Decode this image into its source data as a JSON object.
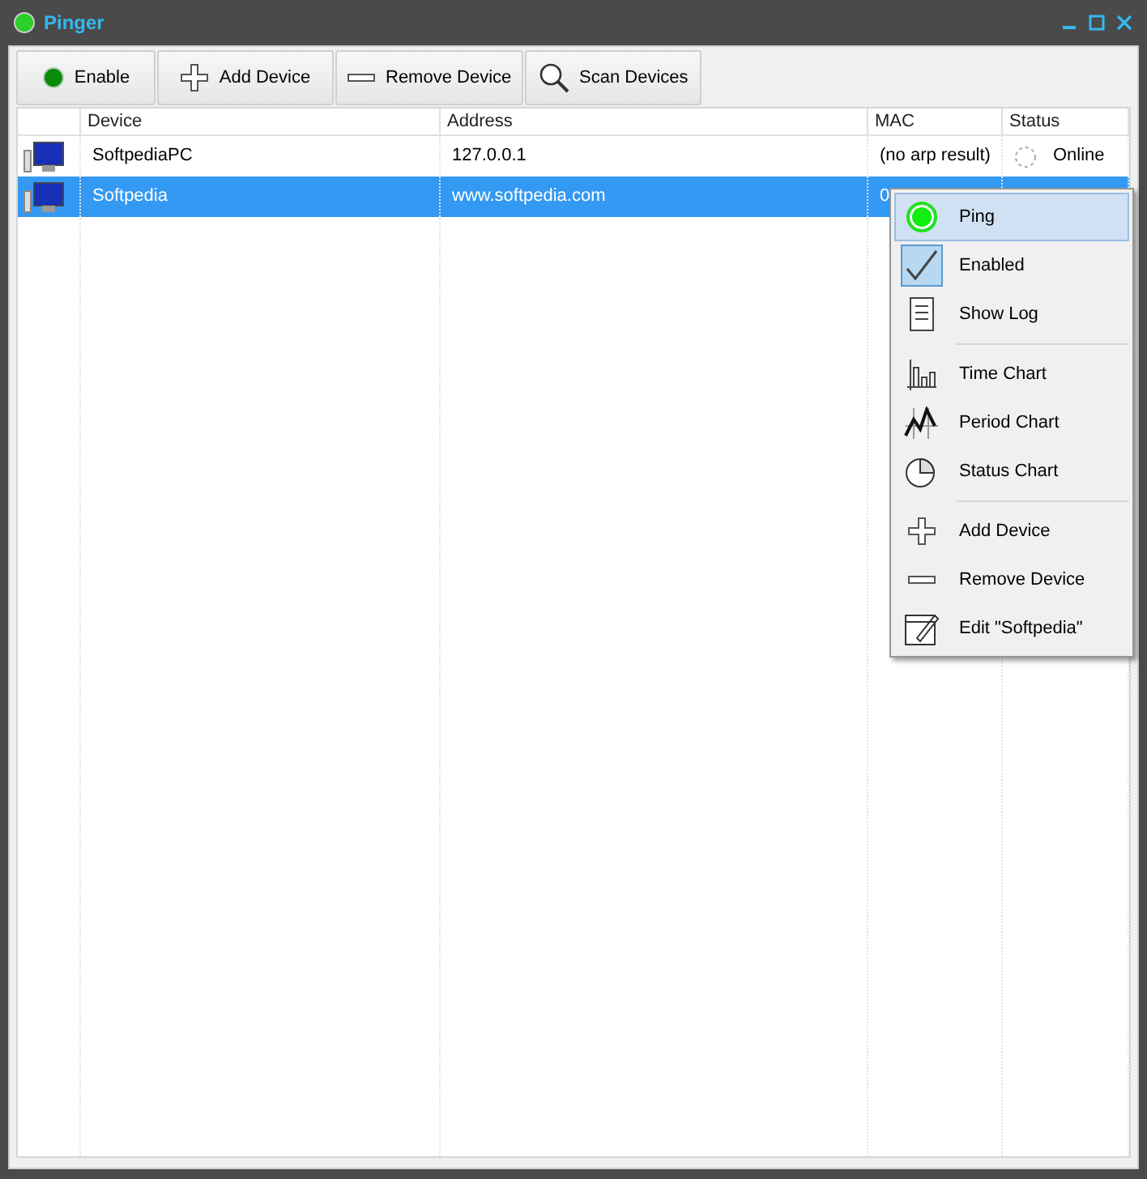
{
  "window": {
    "title": "Pinger"
  },
  "toolbar": [
    {
      "kind": "dot",
      "label": "Enable"
    },
    {
      "kind": "plus",
      "label": "Add Device"
    },
    {
      "kind": "minus",
      "label": "Remove Device"
    },
    {
      "kind": "search",
      "label": "Scan Devices"
    }
  ],
  "table": {
    "columns": [
      "Device",
      "Address",
      "MAC",
      "Status"
    ],
    "rows": [
      {
        "selected": false,
        "device": "SoftpediaPC",
        "address": "127.0.0.1",
        "mac": "(no arp result)",
        "status": "Online"
      },
      {
        "selected": true,
        "device": "Softpedia",
        "address": "www.softpedia.com",
        "mac": "0"
      }
    ]
  },
  "context_menu": {
    "groups": [
      [
        {
          "kind": "ping",
          "label": "Ping",
          "selected": true,
          "checked": false
        },
        {
          "kind": "check",
          "label": "Enabled",
          "selected": false,
          "checked": true
        },
        {
          "kind": "log",
          "label": "Show Log",
          "selected": false,
          "checked": false
        }
      ],
      [
        {
          "kind": "bars",
          "label": "Time Chart",
          "selected": false,
          "checked": false
        },
        {
          "kind": "line",
          "label": "Period Chart",
          "selected": false,
          "checked": false
        },
        {
          "kind": "pie",
          "label": "Status Chart",
          "selected": false,
          "checked": false
        }
      ],
      [
        {
          "kind": "plus",
          "label": "Add Device",
          "selected": false,
          "checked": false
        },
        {
          "kind": "minus",
          "label": "Remove Device",
          "selected": false,
          "checked": false
        },
        {
          "kind": "edit",
          "label": "Edit \"Softpedia\"",
          "selected": false,
          "checked": false
        }
      ]
    ]
  }
}
